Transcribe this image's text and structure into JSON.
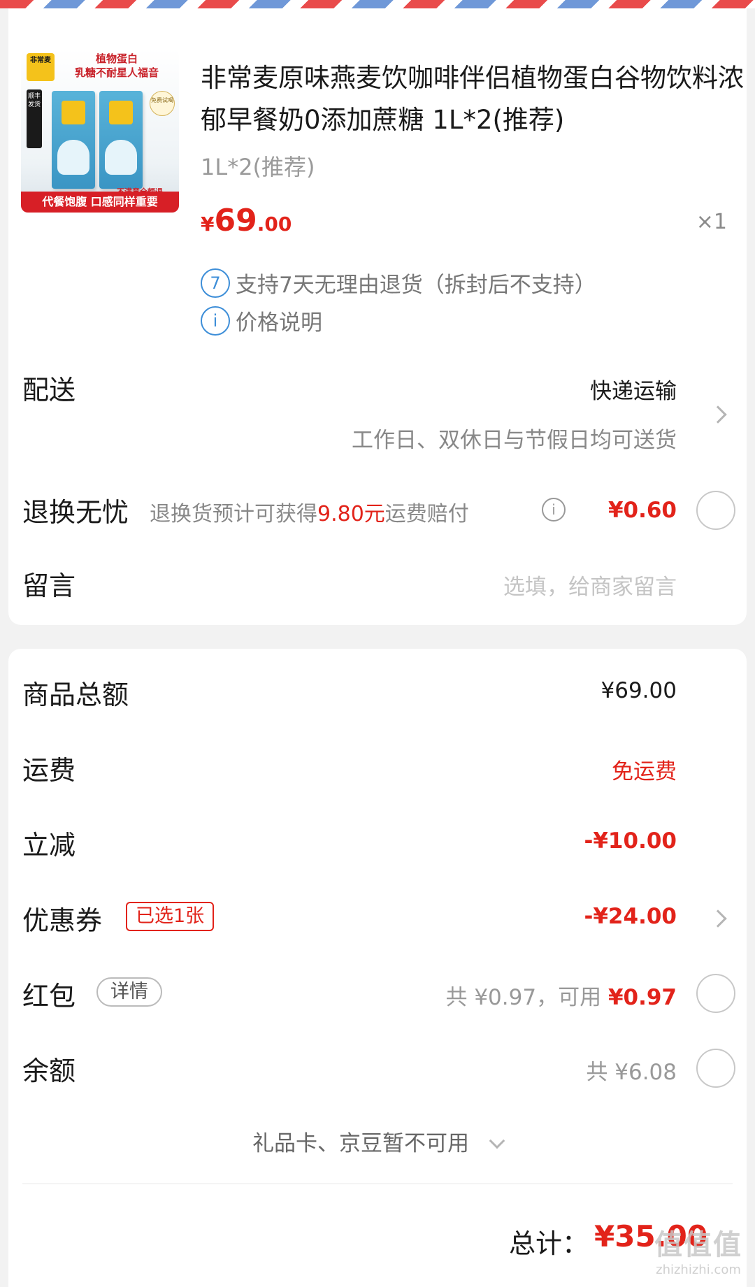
{
  "product": {
    "image": {
      "logo_text": "非常麦",
      "headline": "植物蛋白",
      "subline": "乳糖不耐星人福音",
      "sf_text": "顺丰发货",
      "badge_text": "免费试喝",
      "refund_text": "不满意全额退",
      "banner_text": "代餐饱腹 口感同样重要"
    },
    "title": "非常麦原味燕麦饮咖啡伴侣植物蛋白谷物饮料浓郁早餐奶0添加蔗糖 1L*2(推荐)",
    "spec": "1L*2(推荐)",
    "price_symbol": "¥",
    "price_integer": "69",
    "price_decimal": ".00",
    "quantity": "×1",
    "policies": [
      {
        "icon": "7",
        "text": "支持7天无理由退货（拆封后不支持）"
      },
      {
        "icon": "i",
        "text": "价格说明"
      }
    ]
  },
  "delivery": {
    "label": "配送",
    "method": "快递运输",
    "note": "工作日、双休日与节假日均可送货"
  },
  "return_insurance": {
    "label": "退换无忧",
    "desc_prefix": "退换货预计可获得",
    "desc_amount": "9.80元",
    "desc_suffix": "运费赔付",
    "price": "¥0.60"
  },
  "message": {
    "label": "留言",
    "placeholder": "选填，给商家留言"
  },
  "summary": {
    "goods_total_label": "商品总额",
    "goods_total_value": "¥69.00",
    "shipping_label": "运费",
    "shipping_value": "免运费",
    "discount_label": "立减",
    "discount_value": "-¥10.00",
    "coupon_label": "优惠券",
    "coupon_tag": "已选1张",
    "coupon_value": "-¥24.00",
    "redpacket_label": "红包",
    "redpacket_tag": "详情",
    "redpacket_total": "共 ¥0.97，可用",
    "redpacket_available": "¥0.97",
    "balance_label": "余额",
    "balance_total": "共 ¥6.08",
    "unavailable_note": "礼品卡、京豆暂不可用",
    "total_label": "总计：",
    "total_value": "¥35.00"
  },
  "watermark": {
    "logo": "值值值",
    "url": "zhizhizhi.com"
  },
  "colors": {
    "accent_red": "#e2231a",
    "info_blue": "#3d8ed8",
    "text_gray": "#999999"
  }
}
